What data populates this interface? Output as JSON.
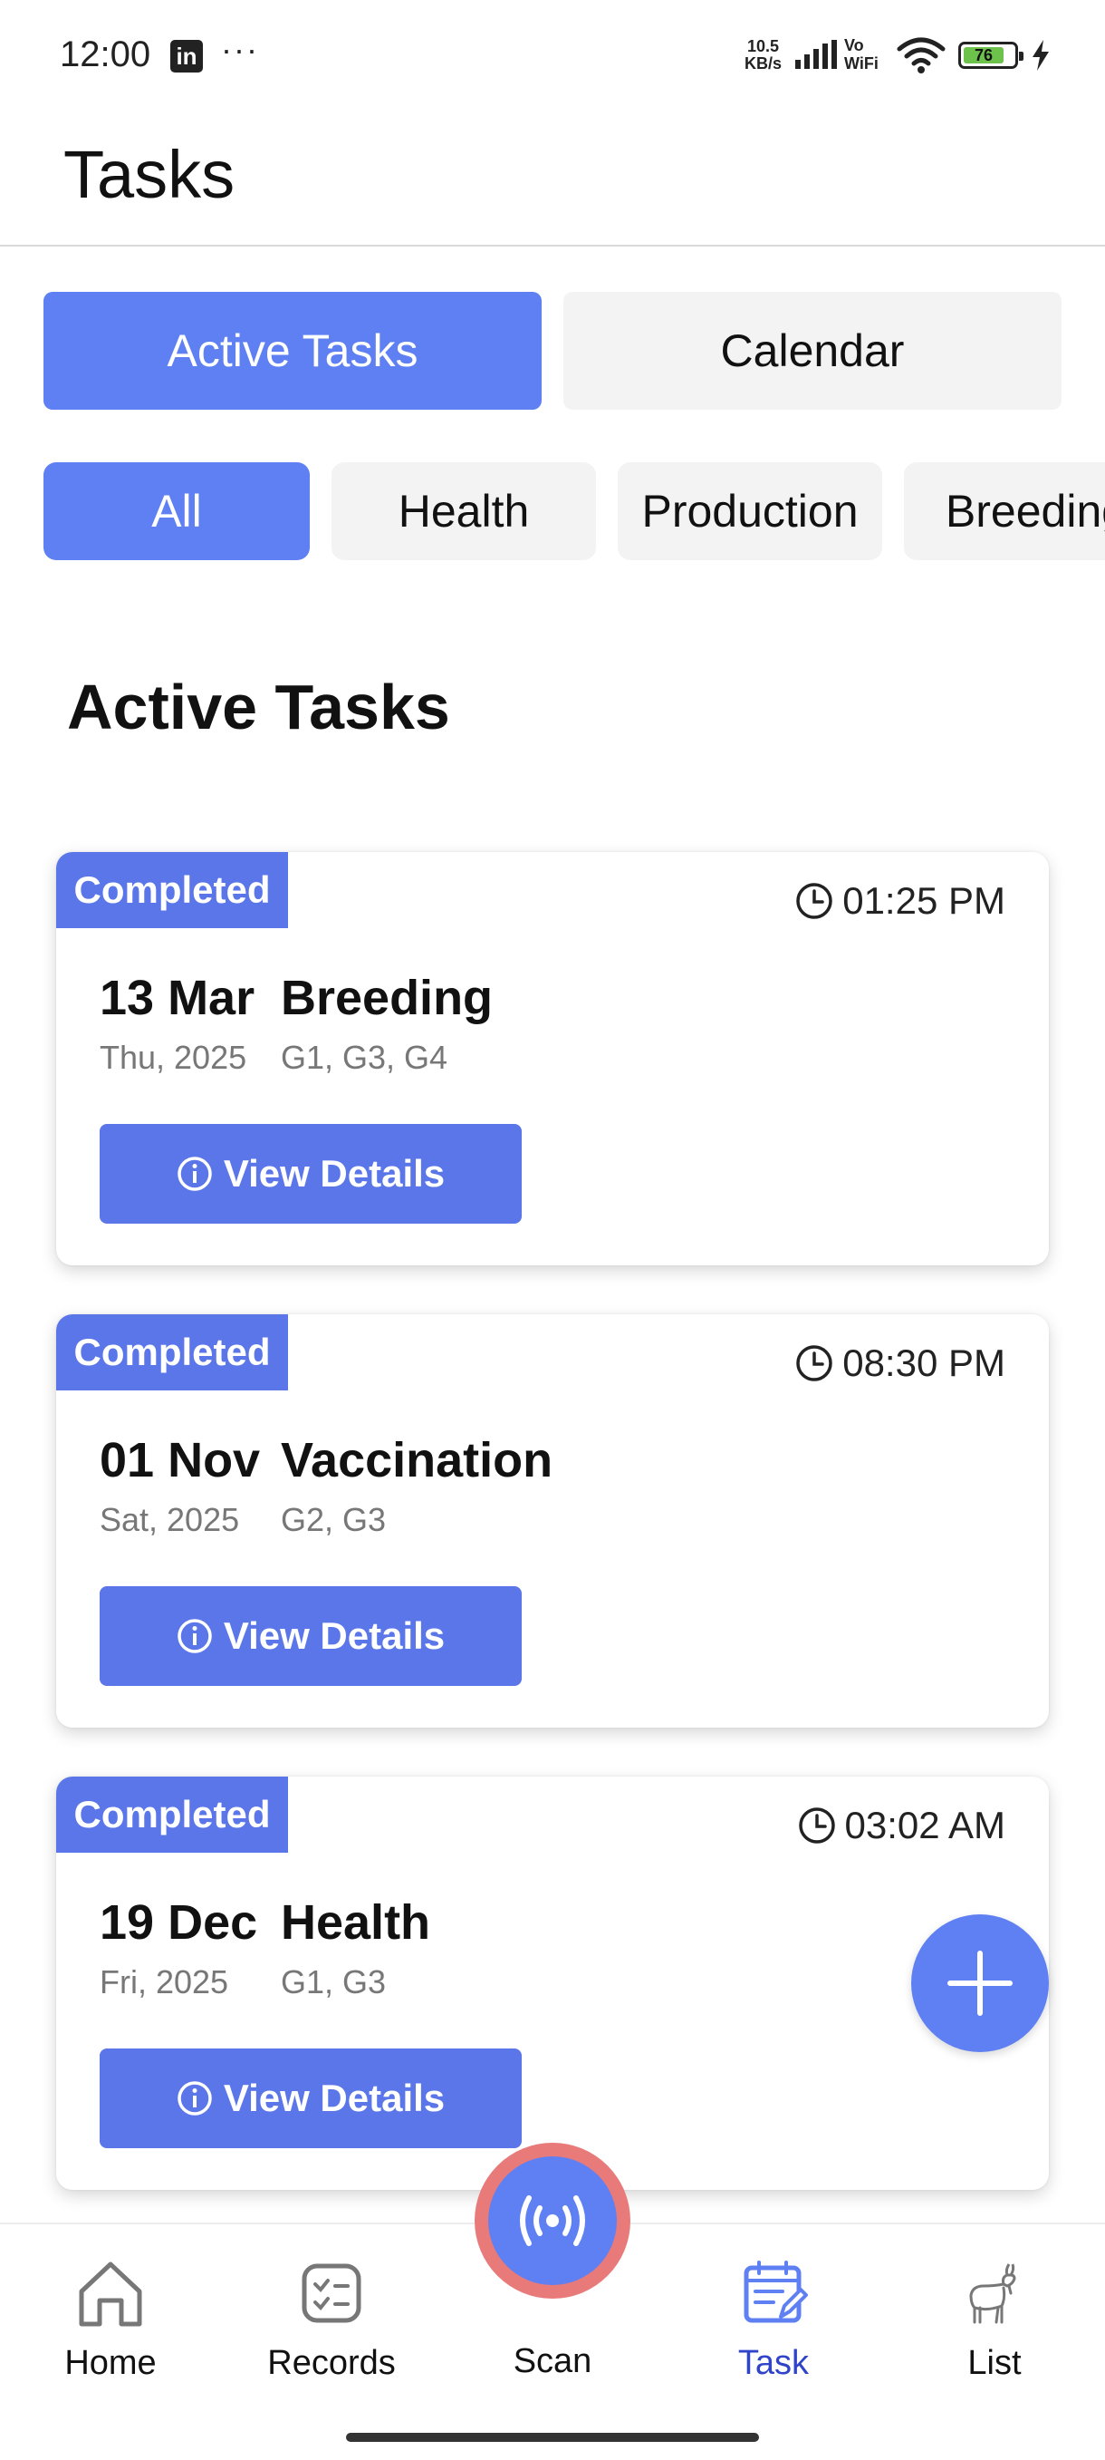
{
  "status_bar": {
    "time": "12:00",
    "linkedin_glyph": "in",
    "more": "···",
    "net_speed_top": "10.5",
    "net_speed_bottom": "KB/s",
    "vowifi_top": "Vo",
    "vowifi_bottom": "WiFi",
    "battery": "76"
  },
  "header": {
    "title": "Tasks"
  },
  "segments": {
    "active_label": "Active Tasks",
    "calendar_label": "Calendar",
    "selected": "Active Tasks"
  },
  "filters": {
    "items": [
      "All",
      "Health",
      "Production",
      "Breeding"
    ],
    "selected": "All"
  },
  "section": {
    "title": "Active Tasks"
  },
  "tasks": [
    {
      "status": "Completed",
      "time": "01:25 PM",
      "date": "13 Mar",
      "day_year": "Thu, 2025",
      "type": "Breeding",
      "groups": "G1, G3, G4",
      "action": "View Details"
    },
    {
      "status": "Completed",
      "time": "08:30 PM",
      "date": "01 Nov",
      "day_year": "Sat, 2025",
      "type": "Vaccination",
      "groups": "G2, G3",
      "action": "View Details"
    },
    {
      "status": "Completed",
      "time": "03:02 AM",
      "date": "19 Dec",
      "day_year": "Fri, 2025",
      "type": "Health",
      "groups": "G1, G3",
      "action": "View Details"
    }
  ],
  "nav": {
    "items": [
      {
        "label": "Home",
        "icon": "home-icon"
      },
      {
        "label": "Records",
        "icon": "checklist-icon"
      },
      {
        "label": "Scan",
        "icon": "broadcast-icon"
      },
      {
        "label": "Task",
        "icon": "task-edit-icon"
      },
      {
        "label": "List",
        "icon": "goat-icon"
      }
    ],
    "active": "Task"
  },
  "colors": {
    "primary": "#5f80f3",
    "badge": "#5a76e8",
    "active_nav": "#2f44c9",
    "scan_ring": "#e87a7a"
  }
}
